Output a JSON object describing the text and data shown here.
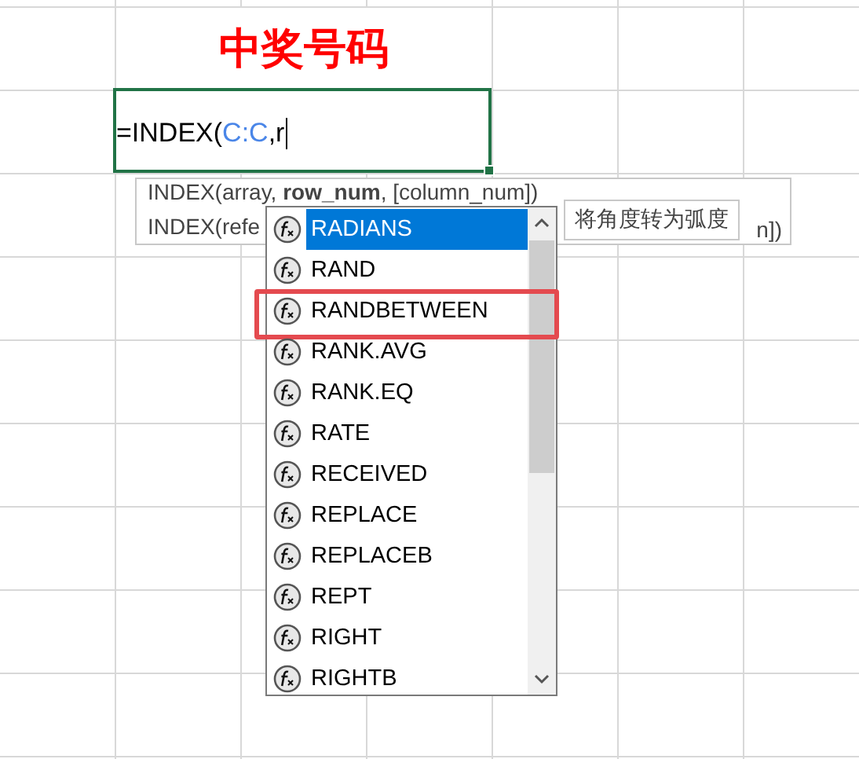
{
  "title": "中奖号码",
  "cell": {
    "prefix": "=INDEX(",
    "reference": "C:C",
    "suffix": ",r"
  },
  "signature_tip": {
    "line_1": {
      "name": "INDEX(array, ",
      "current_arg": "row_num",
      "rest": ", [column_num])"
    },
    "line_2_start": "INDEX(refe",
    "line_2_end": "n])"
  },
  "function_list": [
    {
      "name": "RADIANS",
      "selected": true,
      "highlighted": false
    },
    {
      "name": "RAND",
      "selected": false,
      "highlighted": false
    },
    {
      "name": "RANDBETWEEN",
      "selected": false,
      "highlighted": true
    },
    {
      "name": "RANK.AVG",
      "selected": false,
      "highlighted": false
    },
    {
      "name": "RANK.EQ",
      "selected": false,
      "highlighted": false
    },
    {
      "name": "RATE",
      "selected": false,
      "highlighted": false
    },
    {
      "name": "RECEIVED",
      "selected": false,
      "highlighted": false
    },
    {
      "name": "REPLACE",
      "selected": false,
      "highlighted": false
    },
    {
      "name": "REPLACEB",
      "selected": false,
      "highlighted": false
    },
    {
      "name": "REPT",
      "selected": false,
      "highlighted": false
    },
    {
      "name": "RIGHT",
      "selected": false,
      "highlighted": false
    },
    {
      "name": "RIGHTB",
      "selected": false,
      "highlighted": false
    }
  ],
  "description_tip": "将角度转为弧度"
}
